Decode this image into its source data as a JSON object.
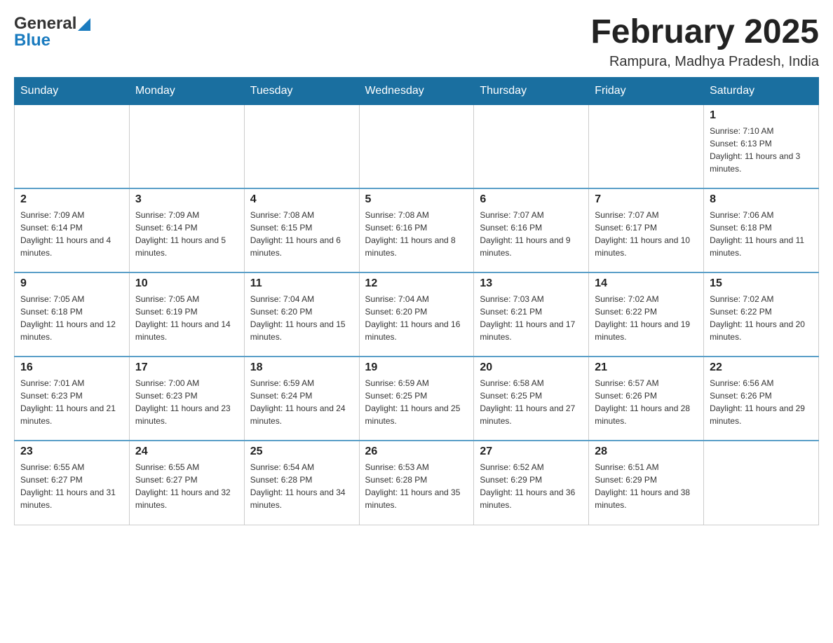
{
  "header": {
    "logo_general": "General",
    "logo_blue": "Blue",
    "month_title": "February 2025",
    "location": "Rampura, Madhya Pradesh, India"
  },
  "weekdays": [
    "Sunday",
    "Monday",
    "Tuesday",
    "Wednesday",
    "Thursday",
    "Friday",
    "Saturday"
  ],
  "weeks": [
    [
      {
        "day": "",
        "info": ""
      },
      {
        "day": "",
        "info": ""
      },
      {
        "day": "",
        "info": ""
      },
      {
        "day": "",
        "info": ""
      },
      {
        "day": "",
        "info": ""
      },
      {
        "day": "",
        "info": ""
      },
      {
        "day": "1",
        "info": "Sunrise: 7:10 AM\nSunset: 6:13 PM\nDaylight: 11 hours and 3 minutes."
      }
    ],
    [
      {
        "day": "2",
        "info": "Sunrise: 7:09 AM\nSunset: 6:14 PM\nDaylight: 11 hours and 4 minutes."
      },
      {
        "day": "3",
        "info": "Sunrise: 7:09 AM\nSunset: 6:14 PM\nDaylight: 11 hours and 5 minutes."
      },
      {
        "day": "4",
        "info": "Sunrise: 7:08 AM\nSunset: 6:15 PM\nDaylight: 11 hours and 6 minutes."
      },
      {
        "day": "5",
        "info": "Sunrise: 7:08 AM\nSunset: 6:16 PM\nDaylight: 11 hours and 8 minutes."
      },
      {
        "day": "6",
        "info": "Sunrise: 7:07 AM\nSunset: 6:16 PM\nDaylight: 11 hours and 9 minutes."
      },
      {
        "day": "7",
        "info": "Sunrise: 7:07 AM\nSunset: 6:17 PM\nDaylight: 11 hours and 10 minutes."
      },
      {
        "day": "8",
        "info": "Sunrise: 7:06 AM\nSunset: 6:18 PM\nDaylight: 11 hours and 11 minutes."
      }
    ],
    [
      {
        "day": "9",
        "info": "Sunrise: 7:05 AM\nSunset: 6:18 PM\nDaylight: 11 hours and 12 minutes."
      },
      {
        "day": "10",
        "info": "Sunrise: 7:05 AM\nSunset: 6:19 PM\nDaylight: 11 hours and 14 minutes."
      },
      {
        "day": "11",
        "info": "Sunrise: 7:04 AM\nSunset: 6:20 PM\nDaylight: 11 hours and 15 minutes."
      },
      {
        "day": "12",
        "info": "Sunrise: 7:04 AM\nSunset: 6:20 PM\nDaylight: 11 hours and 16 minutes."
      },
      {
        "day": "13",
        "info": "Sunrise: 7:03 AM\nSunset: 6:21 PM\nDaylight: 11 hours and 17 minutes."
      },
      {
        "day": "14",
        "info": "Sunrise: 7:02 AM\nSunset: 6:22 PM\nDaylight: 11 hours and 19 minutes."
      },
      {
        "day": "15",
        "info": "Sunrise: 7:02 AM\nSunset: 6:22 PM\nDaylight: 11 hours and 20 minutes."
      }
    ],
    [
      {
        "day": "16",
        "info": "Sunrise: 7:01 AM\nSunset: 6:23 PM\nDaylight: 11 hours and 21 minutes."
      },
      {
        "day": "17",
        "info": "Sunrise: 7:00 AM\nSunset: 6:23 PM\nDaylight: 11 hours and 23 minutes."
      },
      {
        "day": "18",
        "info": "Sunrise: 6:59 AM\nSunset: 6:24 PM\nDaylight: 11 hours and 24 minutes."
      },
      {
        "day": "19",
        "info": "Sunrise: 6:59 AM\nSunset: 6:25 PM\nDaylight: 11 hours and 25 minutes."
      },
      {
        "day": "20",
        "info": "Sunrise: 6:58 AM\nSunset: 6:25 PM\nDaylight: 11 hours and 27 minutes."
      },
      {
        "day": "21",
        "info": "Sunrise: 6:57 AM\nSunset: 6:26 PM\nDaylight: 11 hours and 28 minutes."
      },
      {
        "day": "22",
        "info": "Sunrise: 6:56 AM\nSunset: 6:26 PM\nDaylight: 11 hours and 29 minutes."
      }
    ],
    [
      {
        "day": "23",
        "info": "Sunrise: 6:55 AM\nSunset: 6:27 PM\nDaylight: 11 hours and 31 minutes."
      },
      {
        "day": "24",
        "info": "Sunrise: 6:55 AM\nSunset: 6:27 PM\nDaylight: 11 hours and 32 minutes."
      },
      {
        "day": "25",
        "info": "Sunrise: 6:54 AM\nSunset: 6:28 PM\nDaylight: 11 hours and 34 minutes."
      },
      {
        "day": "26",
        "info": "Sunrise: 6:53 AM\nSunset: 6:28 PM\nDaylight: 11 hours and 35 minutes."
      },
      {
        "day": "27",
        "info": "Sunrise: 6:52 AM\nSunset: 6:29 PM\nDaylight: 11 hours and 36 minutes."
      },
      {
        "day": "28",
        "info": "Sunrise: 6:51 AM\nSunset: 6:29 PM\nDaylight: 11 hours and 38 minutes."
      },
      {
        "day": "",
        "info": ""
      }
    ]
  ],
  "colors": {
    "header_bg": "#1a6fa0",
    "header_text": "#ffffff",
    "border": "#ccc",
    "accent": "#5a9fc8"
  }
}
